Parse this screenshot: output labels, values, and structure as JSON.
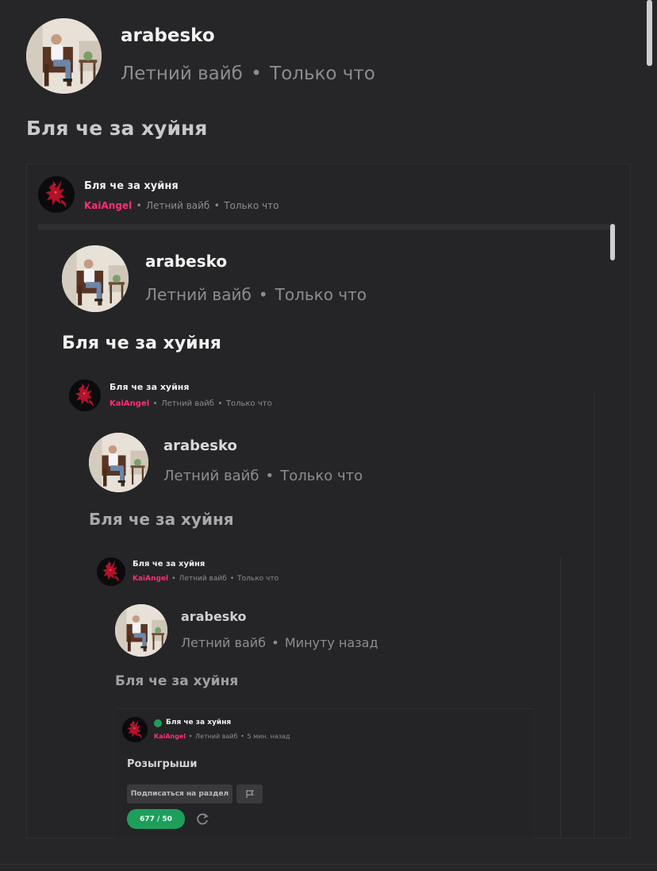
{
  "post": {
    "author": "arabesko",
    "subsite": "Летний вайб",
    "time": "Только что",
    "title": "Бля че за хуйня"
  },
  "embed1": {
    "title": "Бля че за хуйня",
    "author": "KaiAngel",
    "subsite": "Летний вайб",
    "time": "Только что"
  },
  "post2": {
    "author": "arabesko",
    "subsite": "Летний вайб",
    "time": "Только что",
    "title": "Бля че за хуйня"
  },
  "embed2": {
    "title": "Бля че за хуйня",
    "author": "KaiAngel",
    "subsite": "Летний вайб",
    "time": "Только что"
  },
  "post3": {
    "author": "arabesko",
    "subsite": "Летний вайб",
    "time": "Только что",
    "title": "Бля че за хуйня"
  },
  "embed3": {
    "title": "Бля че за хуйня",
    "author": "KaiAngel",
    "subsite": "Летний вайб",
    "time": "Только что"
  },
  "post4": {
    "author": "arabesko",
    "subsite": "Летний вайб",
    "time": "Минуту назад",
    "title": "Бля че за хуйня"
  },
  "embed4": {
    "title": "Бля че за хуйня",
    "author": "KaiAngel",
    "subsite": "Летний вайб",
    "time": "5 мин. назад",
    "section_title": "Розыгрыши",
    "subscribe_label": "Подписаться на раздел",
    "counter": "677 / 50"
  },
  "colors": {
    "background": "#262628",
    "accent_pink": "#ff2d78",
    "accent_green": "#1f9d5b"
  }
}
